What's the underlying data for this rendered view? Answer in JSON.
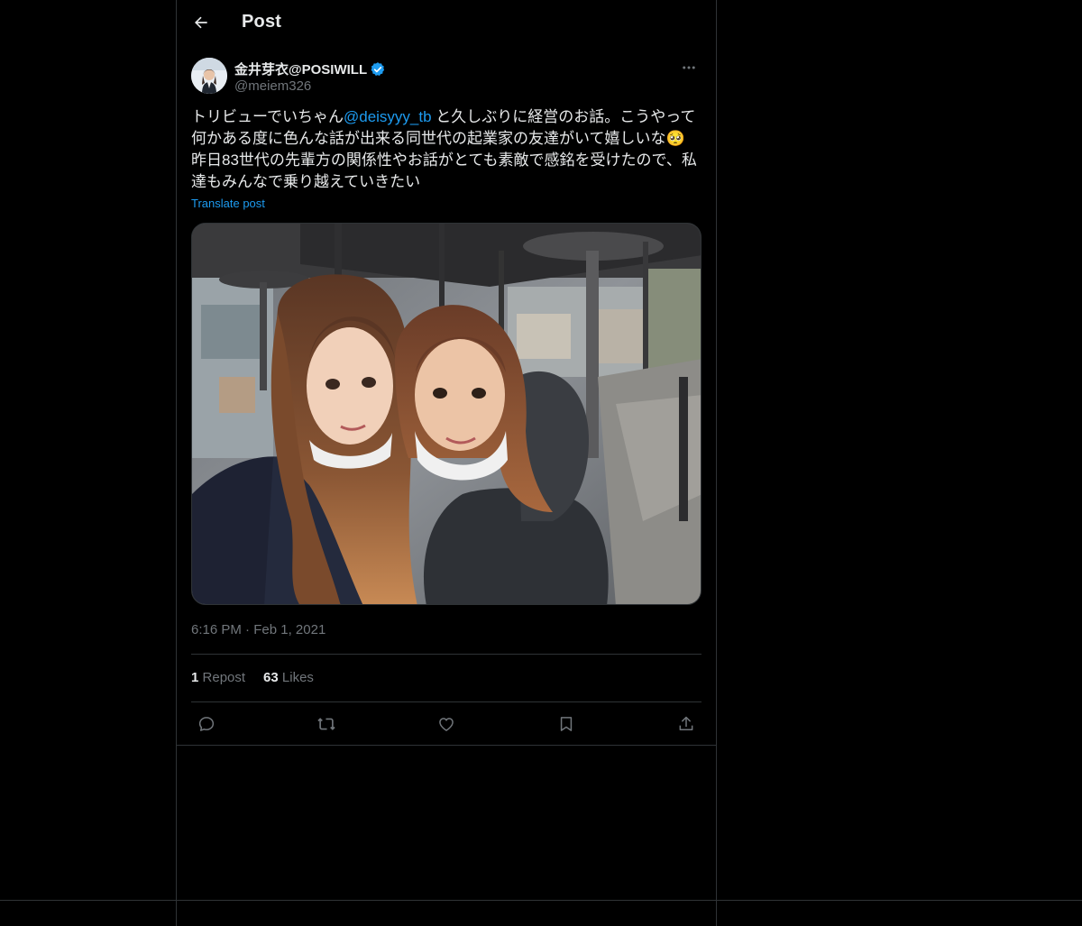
{
  "header": {
    "title": "Post",
    "back_icon": "arrow-left-icon"
  },
  "author": {
    "display_name": "金井芽衣@POSIWILL",
    "handle": "@meiem326",
    "verified_icon": "verified-badge-icon",
    "more_icon": "more-horizontal-icon"
  },
  "tweet": {
    "text_before_mention": "トリビューでいちゃん",
    "mention": "@deisyyy_tb",
    "text_after_mention": " と久しぶりに経営のお話。こうやって何かある度に色んな話が出来る同世代の起業家の友達がいて嬉しいな",
    "emoji": "🥺",
    "text_line2": "昨日83世代の先輩方の関係性やお話がとても素敵で感銘を受けたので、私達もみんなで乗り越えていきたい",
    "translate_label": "Translate post",
    "time": "6:16 PM",
    "separator": "·",
    "date": "Feb 1, 2021"
  },
  "stats": {
    "reposts_count": "1",
    "reposts_label": "Repost",
    "likes_count": "63",
    "likes_label": "Likes"
  },
  "actions": [
    "reply-icon",
    "repost-icon",
    "like-icon",
    "bookmark-icon",
    "share-icon"
  ],
  "colors": {
    "background": "#000000",
    "text": "#e7e9ea",
    "muted": "#71767b",
    "accent": "#1d9bf0",
    "border": "#2f3336"
  }
}
